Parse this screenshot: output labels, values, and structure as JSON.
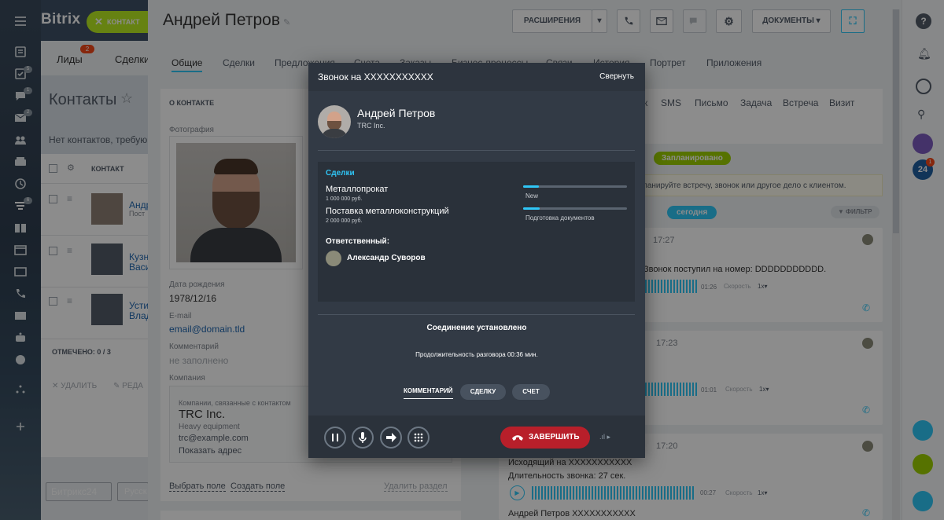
{
  "app": {
    "logo": "Bitrix",
    "contact_pill": "КОНТАКТ"
  },
  "list": {
    "tabs": [
      "Лиды",
      "Сделки"
    ],
    "tab_badge": "2",
    "title": "Контакты",
    "notice": "Нет контактов, требую",
    "col_contact": "КОНТАКТ",
    "rows": [
      {
        "name": "Андр",
        "sub": "Пост"
      },
      {
        "name": "Кузн",
        "sub": "Васи"
      },
      {
        "name": "Усти",
        "sub": "Влад"
      }
    ],
    "marked": "ОТМЕЧЕНО: 0 / 3",
    "delete": "УДАЛИТЬ",
    "edit": "РЕДА",
    "footer_logo": "Битрикс24",
    "lang": "Русск"
  },
  "nav_badges": [
    "5",
    "1",
    "2",
    "6"
  ],
  "card": {
    "title": "Андрей  Петров",
    "buttons": {
      "extensions": "РАСШИРЕНИЯ",
      "documents": "ДОКУМЕНТЫ"
    },
    "tabs": [
      "Общие",
      "Сделки",
      "Предложения",
      "Счета",
      "Заказы",
      "Бизнес-процессы",
      "Связи",
      "История",
      "Портрет",
      "Приложения"
    ],
    "about": {
      "header": "О КОНТАКТЕ",
      "photo_label": "Фотография",
      "birth_label": "Дата рождения",
      "birth": "1978/12/16",
      "email_label": "E-mail",
      "email": "email@domain.tld",
      "comment_label": "Комментарий",
      "comment": "не заполнено",
      "company_label": "Компания",
      "company_sub": "Компании, связанные с контактом",
      "company": "TRC Inc.",
      "company_type": "Heavy equipment",
      "company_email": "trc@example.com",
      "company_addr": "Показать адрес",
      "select_field": "Выбрать поле",
      "create_field": "Создать поле",
      "delete_section": "Удалить раздел"
    },
    "activity_tabs": [
      "к",
      "SMS",
      "Письмо",
      "Задача",
      "Встреча",
      "Визит"
    ],
    "planned": "Запланировано",
    "plan_hint": "ланируйте встречу, звонок или другое дело с клиентом.",
    "today": "сегодня",
    "filter": "ФИЛЬТР",
    "feed": [
      {
        "time": "17:27",
        "text": "Звонок поступил на номер: DDDDDDDDDDD.",
        "dur": "01:26",
        "speed": "Скорость",
        "rate": "1x"
      },
      {
        "time": "17:23",
        "dur": "01:01",
        "speed": "Скорость",
        "rate": "1x"
      },
      {
        "time": "17:20",
        "line1": "Исходящий на XXXXXXXXXXX",
        "line2": "Длительность звонка: 27 сек.",
        "dur": "00:27",
        "speed": "Скорость",
        "rate": "1x",
        "footer": "Андрей Петров XXXXXXXXXXX"
      }
    ]
  },
  "call": {
    "header": "Звонок на XXXXXXXXXXX",
    "minimize": "Свернуть",
    "name": "Андрей Петров",
    "company": "TRC Inc.",
    "deals_title": "Сделки",
    "deals": [
      {
        "name": "Металлопрокат",
        "amount": "1 000 000 руб.",
        "stage": "New",
        "progress": 0.15
      },
      {
        "name": "Поставка металлоконструкций",
        "amount": "2 000 000 руб.",
        "stage": "Подготовка документов",
        "progress": 0.16
      }
    ],
    "responsible_label": "Ответственный:",
    "responsible": "Александр Суворов",
    "status": "Соединение установлено",
    "duration": "Продолжительность разговора 00:36 мин.",
    "actions": [
      "КОММЕНТАРИЙ",
      "СДЕЛКУ",
      "СЧЕТ"
    ],
    "end": "ЗАВЕРШИТЬ"
  },
  "colors": {
    "accent": "#2fc6f6",
    "green": "#bbed21",
    "end": "#b81f2a"
  }
}
